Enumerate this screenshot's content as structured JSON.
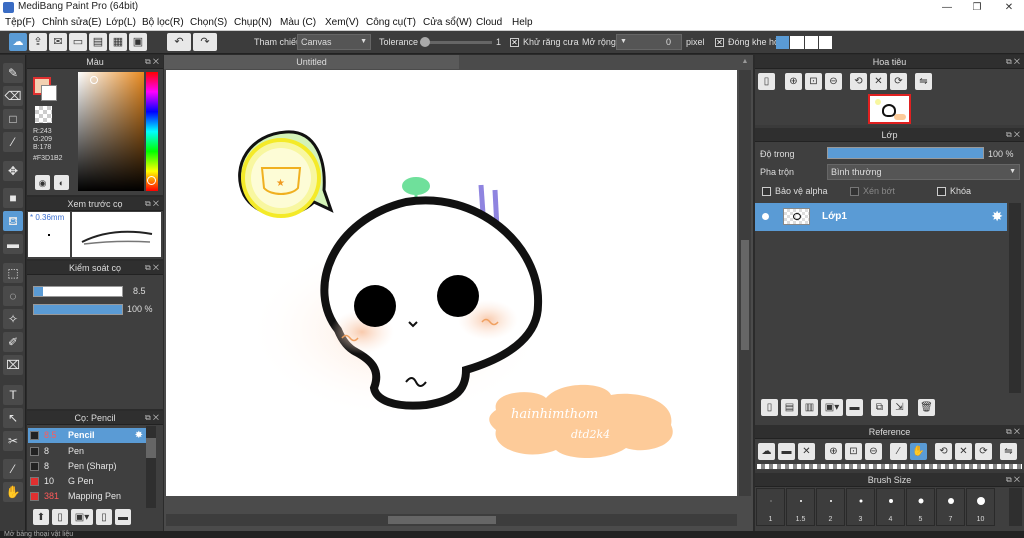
{
  "window": {
    "title": "MediBang Paint Pro (64bit)"
  },
  "menu": [
    "Tệp(F)",
    "Chỉnh sửa(E)",
    "Lớp(L)",
    "Bộ lọc(R)",
    "Chọn(S)",
    "Chụp(N)",
    "Màu (C)",
    "Xem(V)",
    "Công cụ(T)",
    "Cửa sổ(W)",
    "Cloud",
    "Help"
  ],
  "toolbar": {
    "reference_label": "Tham chiếu",
    "reference_value": "Canvas",
    "tolerance_label": "Tolerance",
    "tolerance_value": "1",
    "antialias_label": "Khử răng cưa",
    "expand_label": "Mở rộng",
    "expand_value": "0",
    "expand_unit": "pixel",
    "close_gap_label": "Đóng khe hở"
  },
  "color_panel": {
    "title": "Màu",
    "r": "R:243",
    "g": "G:209",
    "b": "B:178",
    "hex": "#F3D1B2"
  },
  "brush_preview_panel": {
    "title": "Xem trước cọ",
    "size": "0.36mm"
  },
  "brush_control_panel": {
    "title": "Kiểm soát cọ",
    "size_value": "8.5",
    "opacity_value": "100 %",
    "size_level": 0.1,
    "opacity_level": 1.0
  },
  "brush_list_panel": {
    "title": "Cọ: Pencil",
    "items": [
      {
        "size": "8.5",
        "name": "Pencil",
        "selected": true,
        "swatch": "#222222"
      },
      {
        "size": "8",
        "name": "Pen",
        "selected": false,
        "swatch": "#222222"
      },
      {
        "size": "8",
        "name": "Pen (Sharp)",
        "selected": false,
        "swatch": "#222222"
      },
      {
        "size": "10",
        "name": "G Pen",
        "selected": false,
        "swatch": "#e03030"
      },
      {
        "size": "381",
        "name": "Mapping Pen",
        "selected": false,
        "swatch": "#e03030"
      }
    ]
  },
  "canvas": {
    "tab": "Untitled",
    "drawing_text_1": "hainhimthom",
    "drawing_text_2": "dtd2k4"
  },
  "navigator_panel": {
    "title": "Hoa tiêu"
  },
  "layer_panel": {
    "title": "Lớp",
    "opacity_label": "Độ trong",
    "opacity_value": "100 %",
    "opacity_level": 1.0,
    "blend_label": "Pha trộn",
    "blend_value": "Bình thường",
    "protect_alpha": "Bảo vệ alpha",
    "clipping": "Xén bớt",
    "lock": "Khóa",
    "layers": [
      {
        "name": "Lớp1",
        "selected": true
      }
    ]
  },
  "reference_panel": {
    "title": "Reference"
  },
  "brush_size_panel": {
    "title": "Brush Size",
    "sizes": [
      "1",
      "1.5",
      "2",
      "3",
      "4",
      "5",
      "7",
      "10"
    ]
  },
  "status": {
    "text": "Mở bảng thoại vật liệu"
  },
  "colors": {
    "accent": "#5a9bd5",
    "current": "#F3D1B2",
    "panel": "#3f3f3f"
  }
}
